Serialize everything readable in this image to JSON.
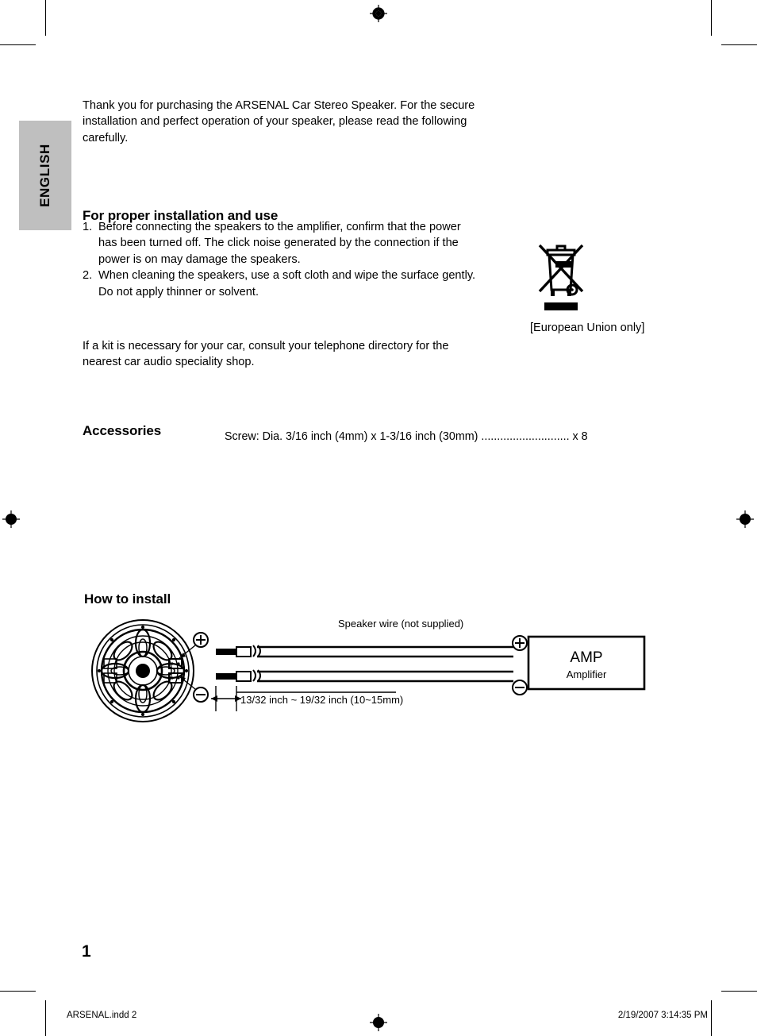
{
  "document": {
    "language_tab": "ENGLISH",
    "page_number": "1"
  },
  "intro": {
    "paragraph": "Thank you for purchasing the ARSENAL Car Stereo Speaker. For the secure installation and perfect operation of your speaker, please read the following carefully."
  },
  "proper_installation": {
    "heading": "For proper installation and use",
    "items": [
      {
        "number": "1.",
        "text": "Before connecting the speakers to the amplifier, confirm that the power has been turned off. The click noise generated by the connection if the power is on may damage the speakers."
      },
      {
        "number": "2.",
        "text": "When cleaning the speakers, use a soft cloth and wipe the surface gently. Do not apply thinner or solvent."
      }
    ],
    "kit_note": "If a kit is necessary for your car, consult your telephone directory  for the nearest car audio speciality shop."
  },
  "weee": {
    "icon": "crossed-out-wheelie-bin-icon",
    "caption": "[European Union only]"
  },
  "accessories": {
    "heading": "Accessories",
    "items": [
      "Screw: Dia. 3/16 inch (4mm) x 1-3/16 inch (30mm) ............................ x 8"
    ]
  },
  "how_to_install": {
    "heading": "How to install",
    "speaker": {
      "icon": "speaker-grille-icon",
      "positive_terminal": "+",
      "negative_terminal": "-"
    },
    "wire_label": "Speaker wire (not supplied)",
    "strip_length_label": "13/32 inch ~ 19/32 inch (10~15mm)",
    "amp": {
      "title": "AMP",
      "subtitle": "Amplifier",
      "positive_terminal": "+",
      "negative_terminal": "-"
    }
  },
  "footer": {
    "file_label": "ARSENAL.indd   2",
    "timestamp": "2/19/2007   3:14:35 PM"
  }
}
